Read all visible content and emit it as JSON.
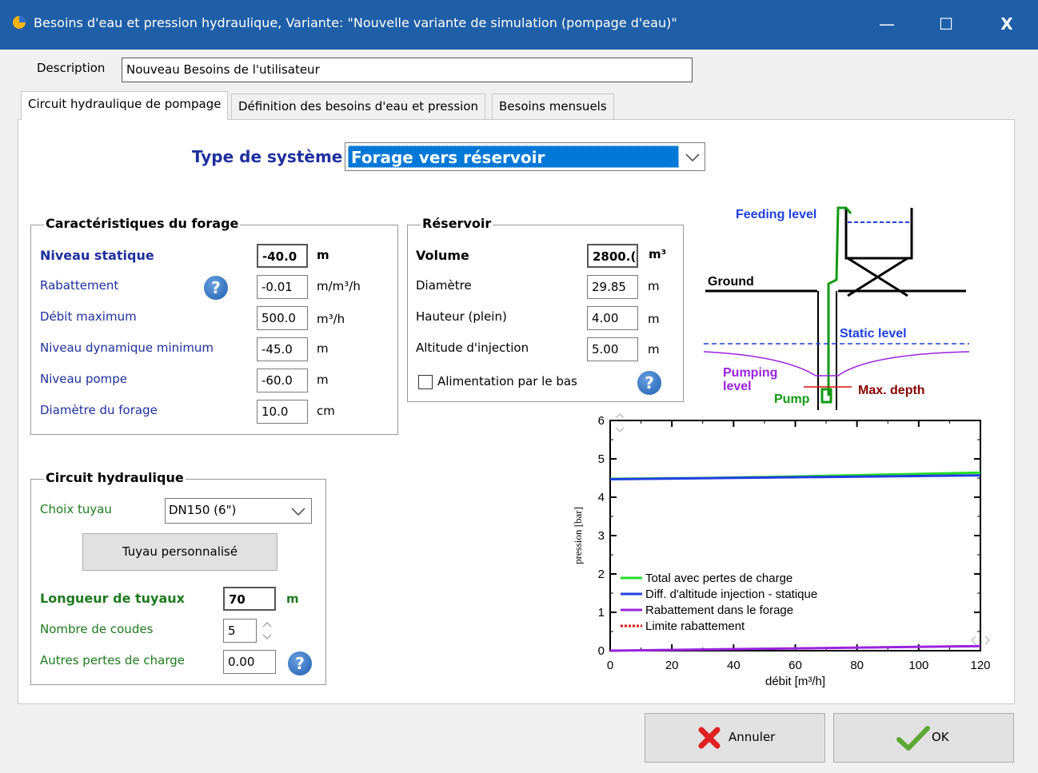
{
  "window": {
    "title": "Besoins d'eau et pression hydraulique, Variante:   \"Nouvelle variante de simulation (pompage d'eau)\"",
    "minimize_label": "—",
    "maximize_label": "☐",
    "close_label": "X"
  },
  "description": {
    "label": "Description",
    "value": "Nouveau Besoins de l'utilisateur"
  },
  "tabs": [
    {
      "label": "Circuit hydraulique de pompage",
      "active": true
    },
    {
      "label": "Définition des besoins d'eau et pression",
      "active": false
    },
    {
      "label": "Besoins mensuels",
      "active": false
    }
  ],
  "system_type": {
    "label": "Type de système",
    "value": "Forage vers réservoir"
  },
  "forage": {
    "title": "Caractéristiques du forage",
    "rows": [
      {
        "label": "Niveau statique",
        "value": "-40.0",
        "unit": "m"
      },
      {
        "label": "Rabattement",
        "value": "-0.01",
        "unit": "m/m³/h"
      },
      {
        "label": "Débit maximum",
        "value": "500.0",
        "unit": "m³/h"
      },
      {
        "label": "Niveau dynamique minimum",
        "value": "-45.0",
        "unit": "m"
      },
      {
        "label": "Niveau pompe",
        "value": "-60.0",
        "unit": "m"
      },
      {
        "label": "Diamètre du forage",
        "value": "10.0",
        "unit": "cm"
      }
    ]
  },
  "reservoir": {
    "title": "Réservoir",
    "rows": [
      {
        "label": "Volume",
        "value": "2800.(",
        "unit": "m³"
      },
      {
        "label": "Diamètre",
        "value": "29.85",
        "unit": "m"
      },
      {
        "label": "Hauteur (plein)",
        "value": "4.00",
        "unit": "m"
      },
      {
        "label": "Altitude d'injection",
        "value": "5.00",
        "unit": "m"
      }
    ],
    "checkbox_label": "Alimentation par le bas",
    "checkbox_checked": false
  },
  "circuit": {
    "title": "Circuit hydraulique",
    "pipe_label": "Choix tuyau",
    "pipe_value": "DN150 (6\")",
    "custom_pipe_button": "Tuyau personnalisé",
    "length_label": "Longueur de tuyaux",
    "length_value": "70",
    "length_unit": "m",
    "elbows_label": "Nombre de coudes",
    "elbows_value": "5",
    "other_losses_label": "Autres pertes de charge",
    "other_losses_value": "0.00"
  },
  "diagram": {
    "feeding_level": "Feeding level",
    "ground": "Ground",
    "static_level": "Static level",
    "pumping_level": "Pumping",
    "pumping_level_2": "level",
    "pump": "Pump",
    "max_depth": "Max. depth"
  },
  "chart_data": {
    "type": "line",
    "xlabel": "débit [m³/h]",
    "ylabel": "pression [bar]",
    "xlim": [
      0,
      120
    ],
    "ylim": [
      0,
      6
    ],
    "xticks": [
      0,
      20,
      40,
      60,
      80,
      100,
      120
    ],
    "yticks": [
      0,
      1,
      2,
      3,
      4,
      5,
      6
    ],
    "legend_position": "lower-left",
    "series": [
      {
        "name": "Total avec pertes de charge",
        "color": "#22dd22",
        "style": "solid",
        "x": [
          0,
          30,
          60,
          90,
          120
        ],
        "y": [
          4.48,
          4.5,
          4.54,
          4.59,
          4.64
        ]
      },
      {
        "name": "Diff. d'altitude injection - statique",
        "color": "#1f3fe0",
        "style": "solid",
        "x": [
          0,
          120
        ],
        "y": [
          4.47,
          4.57
        ]
      },
      {
        "name": "Rabattement dans le forage",
        "color": "#9922dd",
        "style": "solid",
        "x": [
          0,
          120
        ],
        "y": [
          0.0,
          0.12
        ]
      },
      {
        "name": "Limite rabattement",
        "color": "#dd1111",
        "style": "dashed",
        "x": [],
        "y": []
      }
    ]
  },
  "buttons": {
    "cancel": "Annuler",
    "ok": "OK"
  }
}
